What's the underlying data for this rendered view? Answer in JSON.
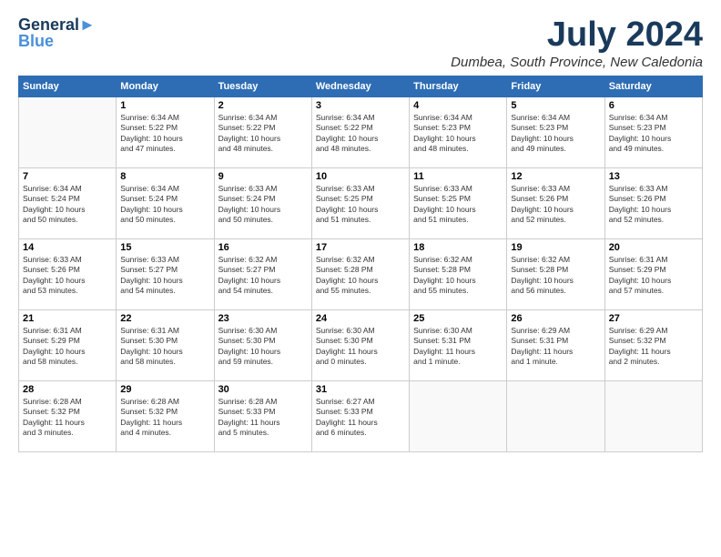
{
  "logo": {
    "line1": "General",
    "line2": "Blue"
  },
  "title": "July 2024",
  "location": "Dumbea, South Province, New Caledonia",
  "weekdays": [
    "Sunday",
    "Monday",
    "Tuesday",
    "Wednesday",
    "Thursday",
    "Friday",
    "Saturday"
  ],
  "weeks": [
    [
      {
        "day": "",
        "info": ""
      },
      {
        "day": "1",
        "info": "Sunrise: 6:34 AM\nSunset: 5:22 PM\nDaylight: 10 hours\nand 47 minutes."
      },
      {
        "day": "2",
        "info": "Sunrise: 6:34 AM\nSunset: 5:22 PM\nDaylight: 10 hours\nand 48 minutes."
      },
      {
        "day": "3",
        "info": "Sunrise: 6:34 AM\nSunset: 5:22 PM\nDaylight: 10 hours\nand 48 minutes."
      },
      {
        "day": "4",
        "info": "Sunrise: 6:34 AM\nSunset: 5:23 PM\nDaylight: 10 hours\nand 48 minutes."
      },
      {
        "day": "5",
        "info": "Sunrise: 6:34 AM\nSunset: 5:23 PM\nDaylight: 10 hours\nand 49 minutes."
      },
      {
        "day": "6",
        "info": "Sunrise: 6:34 AM\nSunset: 5:23 PM\nDaylight: 10 hours\nand 49 minutes."
      }
    ],
    [
      {
        "day": "7",
        "info": "Sunrise: 6:34 AM\nSunset: 5:24 PM\nDaylight: 10 hours\nand 50 minutes."
      },
      {
        "day": "8",
        "info": "Sunrise: 6:34 AM\nSunset: 5:24 PM\nDaylight: 10 hours\nand 50 minutes."
      },
      {
        "day": "9",
        "info": "Sunrise: 6:33 AM\nSunset: 5:24 PM\nDaylight: 10 hours\nand 50 minutes."
      },
      {
        "day": "10",
        "info": "Sunrise: 6:33 AM\nSunset: 5:25 PM\nDaylight: 10 hours\nand 51 minutes."
      },
      {
        "day": "11",
        "info": "Sunrise: 6:33 AM\nSunset: 5:25 PM\nDaylight: 10 hours\nand 51 minutes."
      },
      {
        "day": "12",
        "info": "Sunrise: 6:33 AM\nSunset: 5:26 PM\nDaylight: 10 hours\nand 52 minutes."
      },
      {
        "day": "13",
        "info": "Sunrise: 6:33 AM\nSunset: 5:26 PM\nDaylight: 10 hours\nand 52 minutes."
      }
    ],
    [
      {
        "day": "14",
        "info": "Sunrise: 6:33 AM\nSunset: 5:26 PM\nDaylight: 10 hours\nand 53 minutes."
      },
      {
        "day": "15",
        "info": "Sunrise: 6:33 AM\nSunset: 5:27 PM\nDaylight: 10 hours\nand 54 minutes."
      },
      {
        "day": "16",
        "info": "Sunrise: 6:32 AM\nSunset: 5:27 PM\nDaylight: 10 hours\nand 54 minutes."
      },
      {
        "day": "17",
        "info": "Sunrise: 6:32 AM\nSunset: 5:28 PM\nDaylight: 10 hours\nand 55 minutes."
      },
      {
        "day": "18",
        "info": "Sunrise: 6:32 AM\nSunset: 5:28 PM\nDaylight: 10 hours\nand 55 minutes."
      },
      {
        "day": "19",
        "info": "Sunrise: 6:32 AM\nSunset: 5:28 PM\nDaylight: 10 hours\nand 56 minutes."
      },
      {
        "day": "20",
        "info": "Sunrise: 6:31 AM\nSunset: 5:29 PM\nDaylight: 10 hours\nand 57 minutes."
      }
    ],
    [
      {
        "day": "21",
        "info": "Sunrise: 6:31 AM\nSunset: 5:29 PM\nDaylight: 10 hours\nand 58 minutes."
      },
      {
        "day": "22",
        "info": "Sunrise: 6:31 AM\nSunset: 5:30 PM\nDaylight: 10 hours\nand 58 minutes."
      },
      {
        "day": "23",
        "info": "Sunrise: 6:30 AM\nSunset: 5:30 PM\nDaylight: 10 hours\nand 59 minutes."
      },
      {
        "day": "24",
        "info": "Sunrise: 6:30 AM\nSunset: 5:30 PM\nDaylight: 11 hours\nand 0 minutes."
      },
      {
        "day": "25",
        "info": "Sunrise: 6:30 AM\nSunset: 5:31 PM\nDaylight: 11 hours\nand 1 minute."
      },
      {
        "day": "26",
        "info": "Sunrise: 6:29 AM\nSunset: 5:31 PM\nDaylight: 11 hours\nand 1 minute."
      },
      {
        "day": "27",
        "info": "Sunrise: 6:29 AM\nSunset: 5:32 PM\nDaylight: 11 hours\nand 2 minutes."
      }
    ],
    [
      {
        "day": "28",
        "info": "Sunrise: 6:28 AM\nSunset: 5:32 PM\nDaylight: 11 hours\nand 3 minutes."
      },
      {
        "day": "29",
        "info": "Sunrise: 6:28 AM\nSunset: 5:32 PM\nDaylight: 11 hours\nand 4 minutes."
      },
      {
        "day": "30",
        "info": "Sunrise: 6:28 AM\nSunset: 5:33 PM\nDaylight: 11 hours\nand 5 minutes."
      },
      {
        "day": "31",
        "info": "Sunrise: 6:27 AM\nSunset: 5:33 PM\nDaylight: 11 hours\nand 6 minutes."
      },
      {
        "day": "",
        "info": ""
      },
      {
        "day": "",
        "info": ""
      },
      {
        "day": "",
        "info": ""
      }
    ]
  ]
}
